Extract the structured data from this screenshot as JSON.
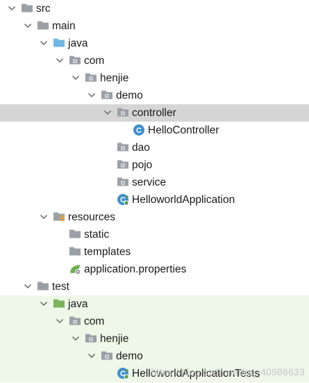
{
  "colors": {
    "folder": "#9aa0a6",
    "source_folder": "#6fb8e6",
    "test_folder": "#7ab55c",
    "class_icon": "#3f8fd0",
    "selected_row": "#d5d5d5",
    "test_bg": "#eef7e8"
  },
  "tree": {
    "items": [
      {
        "label": "src",
        "depth": 0,
        "icon": "folder-icon",
        "expanded": true
      },
      {
        "label": "main",
        "depth": 1,
        "icon": "folder-icon",
        "expanded": true
      },
      {
        "label": "java",
        "depth": 2,
        "icon": "source-folder-icon",
        "expanded": true
      },
      {
        "label": "com",
        "depth": 3,
        "icon": "package-icon",
        "expanded": true
      },
      {
        "label": "henjie",
        "depth": 4,
        "icon": "package-icon",
        "expanded": true
      },
      {
        "label": "demo",
        "depth": 5,
        "icon": "package-icon",
        "expanded": true
      },
      {
        "label": "controller",
        "depth": 6,
        "icon": "package-icon",
        "expanded": true,
        "selected": true
      },
      {
        "label": "HelloController",
        "depth": 7,
        "icon": "class-icon"
      },
      {
        "label": "dao",
        "depth": 6,
        "icon": "package-icon"
      },
      {
        "label": "pojo",
        "depth": 6,
        "icon": "package-icon"
      },
      {
        "label": "service",
        "depth": 6,
        "icon": "package-icon"
      },
      {
        "label": "HelloworldApplication",
        "depth": 6,
        "icon": "spring-boot-class-icon"
      },
      {
        "label": "resources",
        "depth": 2,
        "icon": "resources-folder-icon",
        "expanded": true
      },
      {
        "label": "static",
        "depth": 3,
        "icon": "folder-icon"
      },
      {
        "label": "templates",
        "depth": 3,
        "icon": "folder-icon"
      },
      {
        "label": "application.properties",
        "depth": 3,
        "icon": "spring-properties-icon"
      },
      {
        "label": "test",
        "depth": 1,
        "icon": "folder-icon",
        "expanded": true
      },
      {
        "label": "java",
        "depth": 2,
        "icon": "test-folder-icon",
        "expanded": true,
        "test": true
      },
      {
        "label": "com",
        "depth": 3,
        "icon": "package-icon",
        "expanded": true,
        "test": true
      },
      {
        "label": "henjie",
        "depth": 4,
        "icon": "package-icon",
        "expanded": true,
        "test": true
      },
      {
        "label": "demo",
        "depth": 5,
        "icon": "package-icon",
        "expanded": true,
        "test": true
      },
      {
        "label": "HelloworldApplicationTests",
        "depth": 6,
        "icon": "spring-boot-class-icon",
        "test": true
      }
    ]
  },
  "watermark": "https://blog.csdn.net/qq_40986633"
}
